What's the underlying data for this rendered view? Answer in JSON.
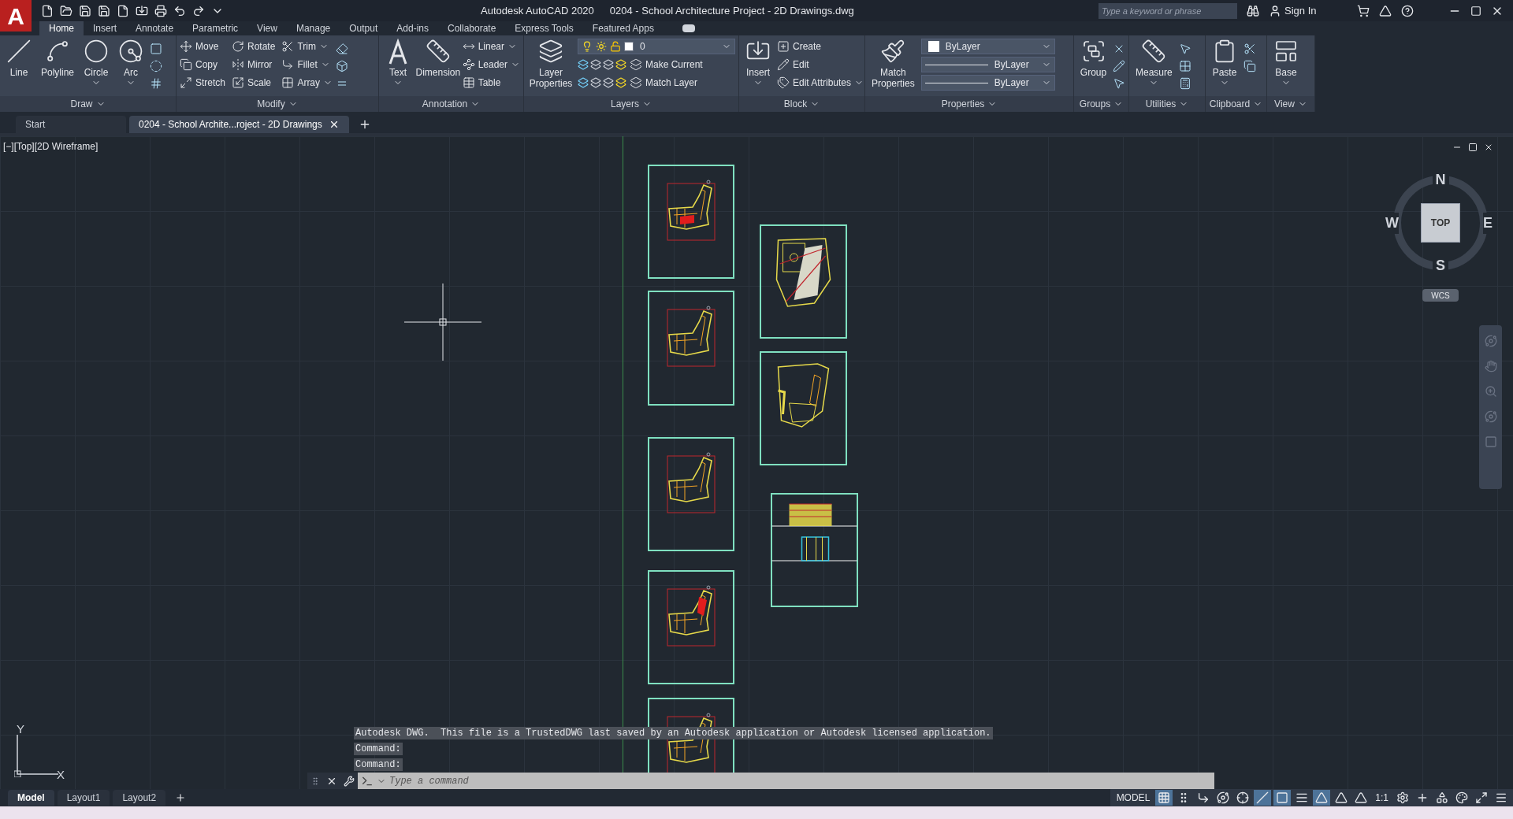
{
  "title_bar": {
    "logo_letter": "A",
    "app_name": "Autodesk AutoCAD 2020",
    "file_name": "0204 - School Architecture Project - 2D Drawings.dwg",
    "search": {
      "placeholder": "Type a keyword or phrase"
    },
    "sign_in": "Sign In"
  },
  "ribbon_tabs": [
    {
      "label": "Home",
      "selected": true
    },
    {
      "label": "Insert",
      "selected": false
    },
    {
      "label": "Annotate",
      "selected": false
    },
    {
      "label": "Parametric",
      "selected": false
    },
    {
      "label": "View",
      "selected": false
    },
    {
      "label": "Manage",
      "selected": false
    },
    {
      "label": "Output",
      "selected": false
    },
    {
      "label": "Add-ins",
      "selected": false
    },
    {
      "label": "Collaborate",
      "selected": false
    },
    {
      "label": "Express Tools",
      "selected": false
    },
    {
      "label": "Featured Apps",
      "selected": false
    }
  ],
  "panels": [
    {
      "title": "Draw",
      "tools": [
        {
          "kind": "large",
          "label": "Line",
          "dropdown": false
        },
        {
          "kind": "large",
          "label": "Polyline",
          "dropdown": false
        },
        {
          "kind": "large",
          "label": "Circle",
          "dropdown": true
        },
        {
          "kind": "large",
          "label": "Arc",
          "dropdown": true
        }
      ]
    },
    {
      "title": "Modify",
      "tools": [
        {
          "kind": "small",
          "label": "Move",
          "dropdown": false
        },
        {
          "kind": "small",
          "label": "Copy",
          "dropdown": false
        },
        {
          "kind": "small",
          "label": "Stretch",
          "dropdown": false
        },
        {
          "kind": "small",
          "label": "Rotate",
          "dropdown": false
        },
        {
          "kind": "small",
          "label": "Mirror",
          "dropdown": false
        },
        {
          "kind": "small",
          "label": "Scale",
          "dropdown": false
        },
        {
          "kind": "small",
          "label": "Trim",
          "dropdown": true
        },
        {
          "kind": "small",
          "label": "Fillet",
          "dropdown": true
        },
        {
          "kind": "small",
          "label": "Array",
          "dropdown": true
        }
      ]
    },
    {
      "title": "Annotation",
      "tools": [
        {
          "kind": "large",
          "label": "Text",
          "dropdown": true
        },
        {
          "kind": "large",
          "label": "Dimension",
          "dropdown": false
        },
        {
          "kind": "small",
          "label": "Linear",
          "dropdown": true
        },
        {
          "kind": "small",
          "label": "Leader",
          "dropdown": true
        },
        {
          "kind": "small",
          "label": "Table",
          "dropdown": false
        }
      ]
    },
    {
      "title": "Layers",
      "tools": [
        {
          "kind": "large",
          "label": "Layer Properties",
          "dropdown": false
        },
        {
          "kind": "field",
          "value": "0"
        },
        {
          "kind": "small",
          "label": "Make Current",
          "dropdown": false
        },
        {
          "kind": "small",
          "label": "Match Layer",
          "dropdown": false
        }
      ]
    },
    {
      "title": "Block",
      "tools": [
        {
          "kind": "large",
          "label": "Insert",
          "dropdown": true
        },
        {
          "kind": "small",
          "label": "Create",
          "dropdown": false
        },
        {
          "kind": "small",
          "label": "Edit",
          "dropdown": false
        },
        {
          "kind": "small",
          "label": "Edit Attributes",
          "dropdown": true
        }
      ]
    },
    {
      "title": "Properties",
      "tools": [
        {
          "kind": "large",
          "label": "Match Properties",
          "dropdown": false
        },
        {
          "kind": "field",
          "value": "ByLayer"
        },
        {
          "kind": "field",
          "value": "ByLayer"
        },
        {
          "kind": "field",
          "value": "ByLayer"
        }
      ]
    },
    {
      "title": "Groups",
      "tools": [
        {
          "kind": "large",
          "label": "Group",
          "dropdown": false
        }
      ]
    },
    {
      "title": "Utilities",
      "tools": [
        {
          "kind": "large",
          "label": "Measure",
          "dropdown": true
        }
      ]
    },
    {
      "title": "Clipboard",
      "tools": [
        {
          "kind": "large",
          "label": "Paste",
          "dropdown": true
        }
      ]
    },
    {
      "title": "View",
      "tools": [
        {
          "kind": "large",
          "label": "Base",
          "dropdown": true
        }
      ]
    }
  ],
  "file_tabs": [
    {
      "label": "Start",
      "selected": false,
      "closable": false
    },
    {
      "label": "0204 - School Archite...roject - 2D Drawings",
      "selected": true,
      "closable": true
    }
  ],
  "viewport_label": "[−][Top][2D Wireframe]",
  "viewcube": {
    "north": "N",
    "south": "S",
    "east": "E",
    "west": "W",
    "face": "TOP",
    "ucs": "WCS"
  },
  "ucs_icon": {
    "y": "Y",
    "x": "X"
  },
  "command_history": [
    "Autodesk DWG.  This file is a TrustedDWG last saved by an Autodesk application or Autodesk licensed application.",
    "Command:",
    "Command:"
  ],
  "command_line": {
    "placeholder": "Type a command"
  },
  "layout_tabs": [
    {
      "label": "Model",
      "selected": true
    },
    {
      "label": "Layout1",
      "selected": false
    },
    {
      "label": "Layout2",
      "selected": false
    }
  ],
  "status_bar": {
    "space": "MODEL",
    "scale": "1:1",
    "toggles": [
      {
        "on": true
      },
      {
        "on": false
      },
      {
        "on": false
      },
      {
        "on": false
      },
      {
        "on": false
      },
      {
        "on": true
      },
      {
        "on": true
      },
      {
        "on": false
      },
      {
        "on": true
      },
      {
        "on": false
      },
      {
        "on": false
      }
    ]
  }
}
